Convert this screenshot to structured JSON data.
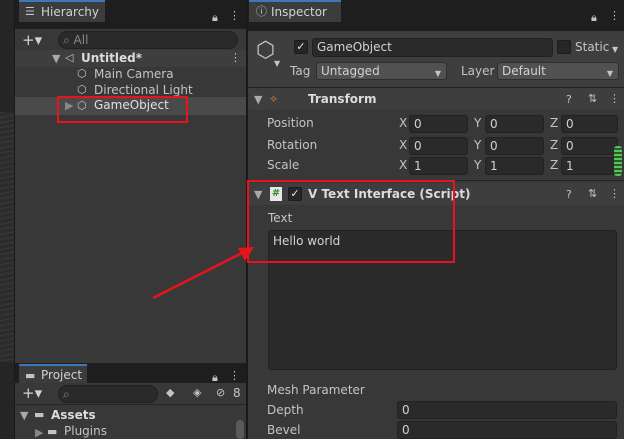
{
  "hierarchy": {
    "tab": "Hierarchy",
    "search_placeholder": "All",
    "scene": "Untitled*",
    "items": [
      "Main Camera",
      "Directional Light",
      "GameObject"
    ]
  },
  "project": {
    "tab": "Project",
    "hidden_count": "8",
    "assets": "Assets",
    "plugins": "Plugins"
  },
  "inspector": {
    "tab": "Inspector",
    "object_name": "GameObject",
    "static_label": "Static",
    "tag_label": "Tag",
    "tag_value": "Untagged",
    "layer_label": "Layer",
    "layer_value": "Default",
    "transform": {
      "title": "Transform",
      "rows": [
        {
          "label": "Position",
          "x": "0",
          "y": "0",
          "z": "0"
        },
        {
          "label": "Rotation",
          "x": "0",
          "y": "0",
          "z": "0"
        },
        {
          "label": "Scale",
          "x": "1",
          "y": "1",
          "z": "1"
        }
      ],
      "axis_x": "X",
      "axis_y": "Y",
      "axis_z": "Z"
    },
    "script": {
      "title": "V Text Interface (Script)",
      "text_label": "Text",
      "text_value": "Hello world"
    },
    "mesh": {
      "title": "Mesh Parameter",
      "depth_label": "Depth",
      "depth_value": "0",
      "bevel_label": "Bevel",
      "bevel_value": "0"
    }
  },
  "colors": {
    "highlight_red": "#e8141c",
    "accent_blue": "#3a79bb",
    "panel_bg": "#383838"
  }
}
